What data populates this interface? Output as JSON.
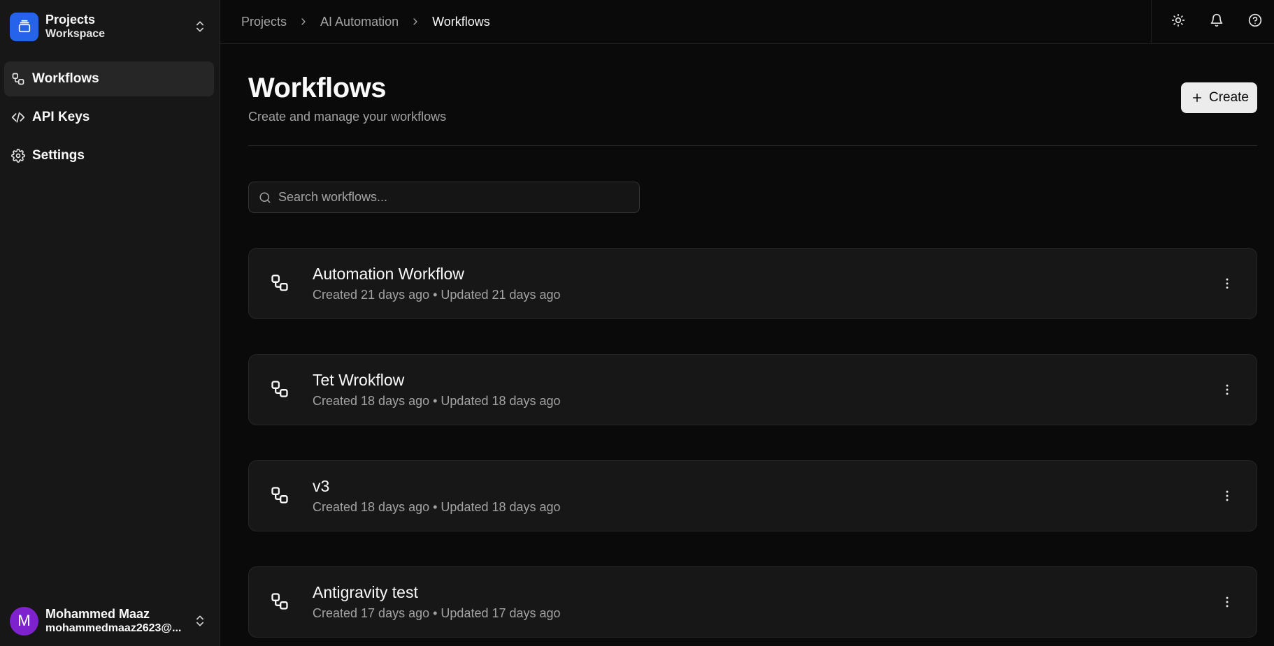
{
  "workspace": {
    "title": "Projects",
    "subtitle": "Workspace"
  },
  "sidebar": {
    "items": [
      {
        "label": "Workflows",
        "icon": "workflow-icon",
        "active": true
      },
      {
        "label": "API Keys",
        "icon": "code-icon"
      },
      {
        "label": "Settings",
        "icon": "gear-icon"
      }
    ]
  },
  "user": {
    "initial": "M",
    "name": "Mohammed Maaz",
    "email": "mohammedmaaz2623@..."
  },
  "breadcrumb": [
    "Projects",
    "AI Automation",
    "Workflows"
  ],
  "page": {
    "title": "Workflows",
    "subtitle": "Create and manage your workflows",
    "create_label": "Create"
  },
  "search": {
    "placeholder": "Search workflows...",
    "value": ""
  },
  "workflows": [
    {
      "name": "Automation Workflow",
      "meta": "Created 21 days ago • Updated 21 days ago"
    },
    {
      "name": "Tet Wrokflow",
      "meta": "Created 18 days ago • Updated 18 days ago"
    },
    {
      "name": "v3",
      "meta": "Created 18 days ago • Updated 18 days ago"
    },
    {
      "name": "Antigravity test",
      "meta": "Created 17 days ago • Updated 17 days ago"
    }
  ],
  "colors": {
    "brand": "#2563eb",
    "avatar": "#7e22ce",
    "background": "#0a0a0a",
    "sidebar": "#171717"
  }
}
